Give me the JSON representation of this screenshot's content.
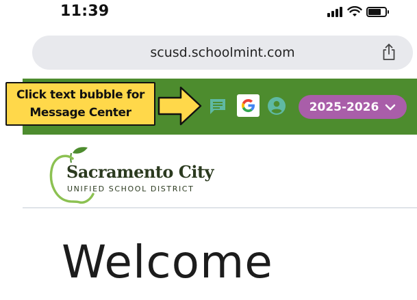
{
  "status_bar": {
    "time": "11:39"
  },
  "browser": {
    "url": "scusd.schoolmint.com"
  },
  "header": {
    "callout": {
      "line1": "Click text bubble for",
      "line2": "Message Center"
    },
    "year_select": {
      "selected": "2025-2026"
    }
  },
  "logo": {
    "name": "Sacramento City",
    "subtitle": "UNIFIED SCHOOL DISTRICT"
  },
  "main": {
    "welcome": "Welcome"
  },
  "colors": {
    "header_green": "#4d8c2e",
    "callout_yellow": "#ffd84a",
    "year_purple": "#a95ea9",
    "icon_teal": "#5fb9a3"
  }
}
